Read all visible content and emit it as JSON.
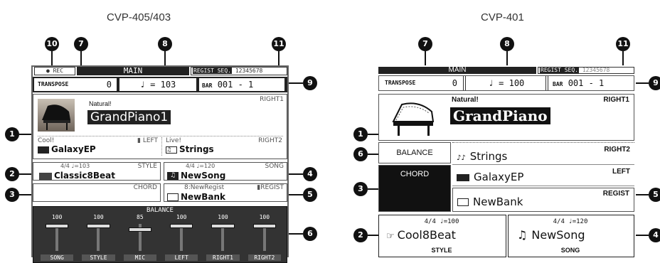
{
  "left": {
    "model": "CVP-405/403",
    "rec": "● REC",
    "title": "MAIN",
    "regist_seq_label": "REGIST SEQ.",
    "regist_seq_value": "12345678",
    "transpose_label": "TRANSPOSE",
    "transpose_value": "0",
    "tempo": "♩ = 103",
    "bar_label": "BAR",
    "bar_value": "001 -  1",
    "right1_label": "RIGHT1",
    "right1_category": "Natural!",
    "right1_voice": "GrandPiano1",
    "left_category": "Cool!",
    "left_voice": "GalaxyEP",
    "left_label": "LEFT",
    "right2_category": "Live!",
    "right2_voice": "Strings",
    "right2_label": "RIGHT2",
    "style_meta": "4/4  ♩=103",
    "style_label": "STYLE",
    "style_name": "Classic8Beat",
    "song_meta": "4/4  ♩=120",
    "song_label": "SONG",
    "song_name": "NewSong",
    "chord_label": "CHORD",
    "regist_meta": "8:NewRegist",
    "regist_label": "REGIST",
    "regist_bank": "NewBank",
    "balance_label": "BALANCE",
    "balance_channels": [
      {
        "name": "SONG",
        "value": "100",
        "level": 1.0
      },
      {
        "name": "STYLE",
        "value": "100",
        "level": 1.0
      },
      {
        "name": "MIC",
        "value": "85",
        "level": 0.85
      },
      {
        "name": "LEFT",
        "value": "100",
        "level": 1.0
      },
      {
        "name": "RIGHT1",
        "value": "100",
        "level": 1.0
      },
      {
        "name": "RIGHT2",
        "value": "100",
        "level": 1.0
      }
    ]
  },
  "right": {
    "model": "CVP-401",
    "title": "MAIN",
    "regist_seq_label": "REGIST SEQ.",
    "regist_seq_value": "12345678",
    "transpose_label": "TRANSPOSE",
    "transpose_value": "0",
    "tempo": "♩ = 100",
    "bar_label": "BAR",
    "bar_value": "001 -  1",
    "right1_category": "Natural!",
    "right1_label": "RIGHT1",
    "right1_voice": "GrandPiano",
    "balance_button": "BALANCE",
    "chord_button": "CHORD",
    "right2_voice": "Strings",
    "right2_label": "RIGHT2",
    "left_voice": "GalaxyEP",
    "left_label": "LEFT",
    "regist_bank": "NewBank",
    "regist_label": "REGIST",
    "style_meta": "4/4   ♩=100",
    "style_name": "Cool8Beat",
    "style_label": "STYLE",
    "song_meta": "4/4   ♩=120",
    "song_name": "NewSong",
    "song_label": "SONG"
  },
  "callouts": [
    "1",
    "2",
    "3",
    "4",
    "5",
    "6",
    "7",
    "8",
    "9",
    "10",
    "11"
  ]
}
